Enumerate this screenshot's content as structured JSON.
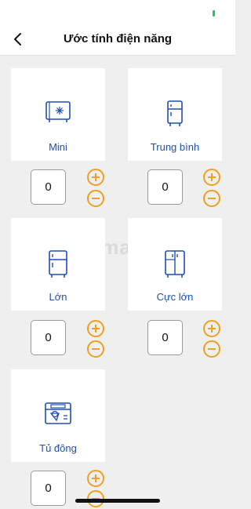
{
  "header": {
    "title": "Ước tính điện năng"
  },
  "watermark": "uantrimang",
  "appliances": [
    {
      "label": "Mini",
      "icon": "mini-fridge-icon",
      "quantity": "0"
    },
    {
      "label": "Trung bình",
      "icon": "medium-fridge-icon",
      "quantity": "0"
    },
    {
      "label": "Lớn",
      "icon": "large-fridge-icon",
      "quantity": "0"
    },
    {
      "label": "Cực lớn",
      "icon": "extra-large-fridge-icon",
      "quantity": "0"
    },
    {
      "label": "Tủ đông",
      "icon": "freezer-icon",
      "quantity": "0"
    }
  ],
  "colors": {
    "accent": "#f0a020",
    "label": "#1f4fb2",
    "status_battery": "#22c55e"
  }
}
